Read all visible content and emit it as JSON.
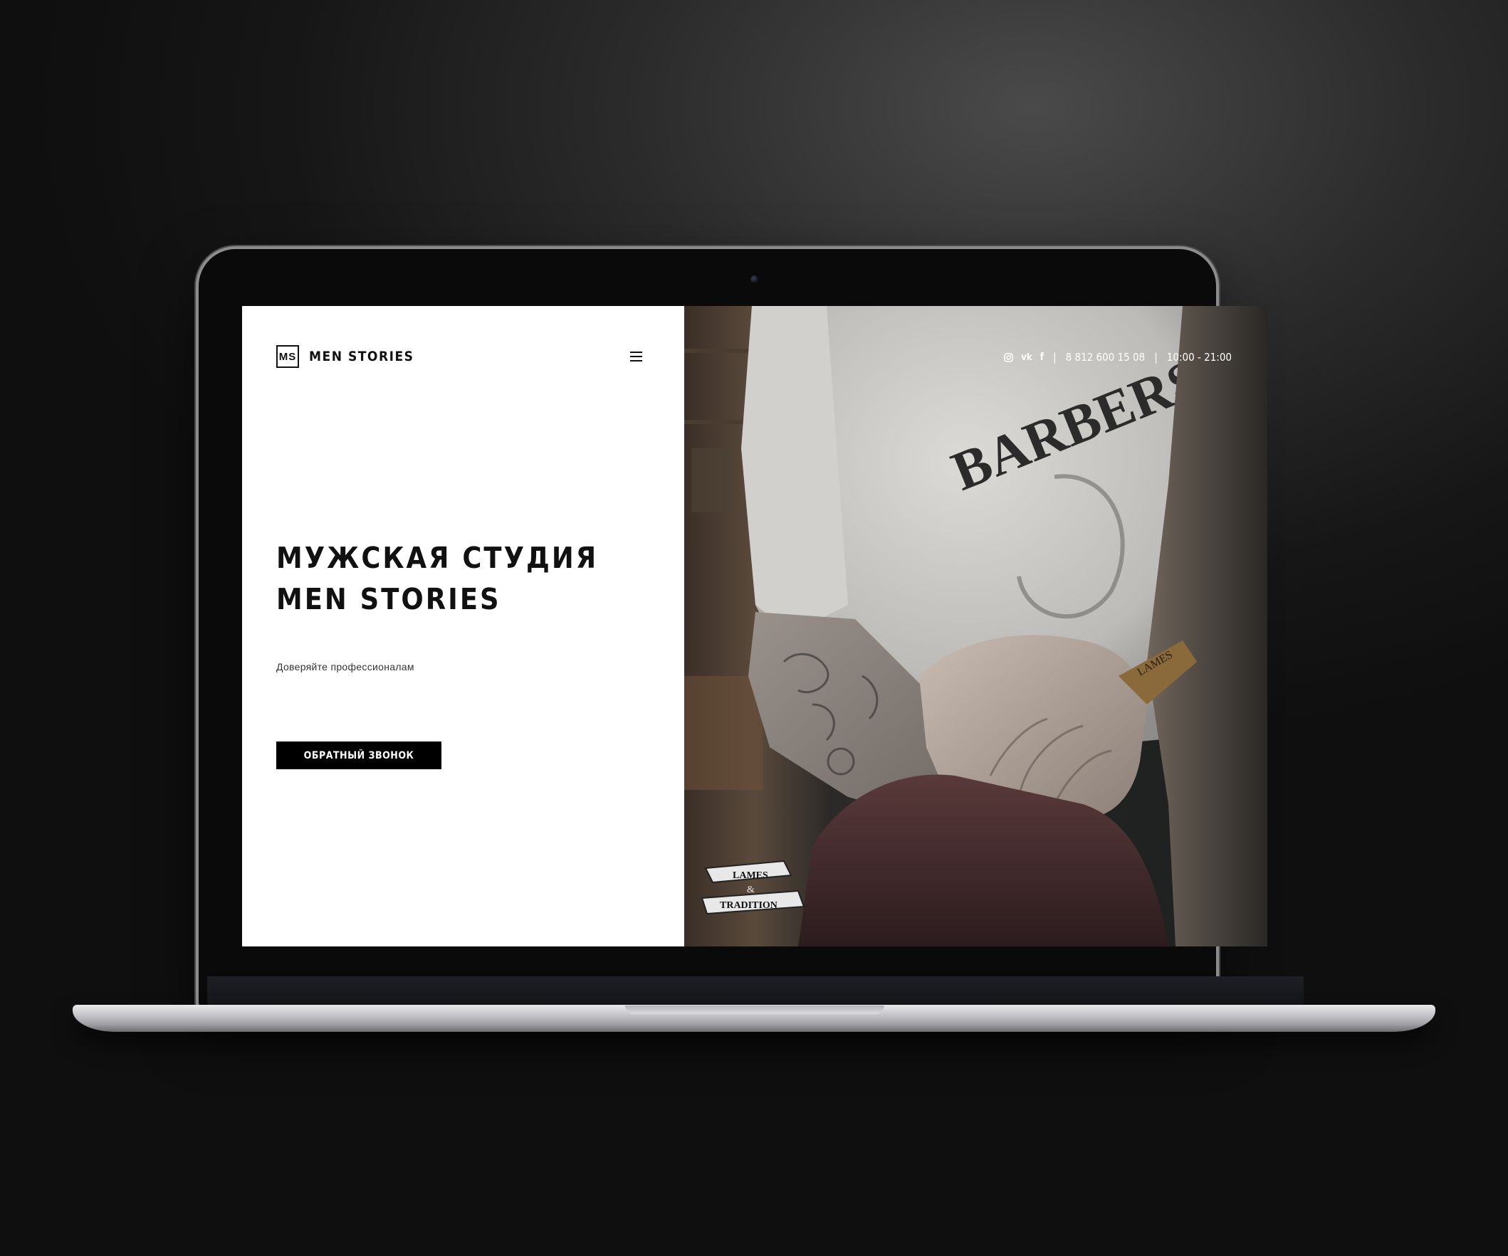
{
  "site": {
    "logo_mark": "MS",
    "logo_text": "MEN STORIES"
  },
  "hero": {
    "headline_line1": "МУЖСКАЯ СТУДИЯ",
    "headline_line2": "MEN STORIES",
    "tagline": "Доверяйте профессионалам",
    "cta_label": "ОБРАТНЫЙ ЗВОНОК"
  },
  "topbar": {
    "social_icons": [
      "instagram-icon",
      "vk-icon",
      "facebook-icon"
    ],
    "vk_label": "vk",
    "facebook_label": "f",
    "separator": "|",
    "phone": "8 812 600 15 08",
    "hours": "10:00 - 21:00"
  },
  "photo": {
    "shirt_text": "BARBERS",
    "comb_text": "LAMES",
    "badge_line1": "LAMES",
    "badge_line2": "&",
    "badge_line3": "TRADITION"
  },
  "colors": {
    "accent": "#000000",
    "background": "#ffffff",
    "device_background": "#1a1a1a"
  }
}
